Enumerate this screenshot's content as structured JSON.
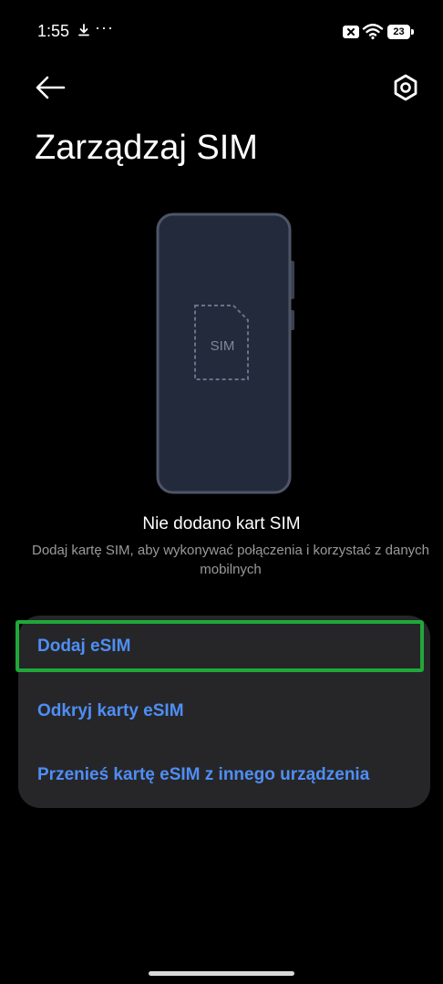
{
  "status_bar": {
    "time": "1:55",
    "more": "···",
    "battery_level": "23",
    "icons": [
      "download-icon",
      "sim-disabled-icon",
      "wifi-icon",
      "battery-icon"
    ]
  },
  "header": {
    "title": "Zarządzaj SIM",
    "back_icon": "back-arrow-icon",
    "settings_icon": "settings-icon"
  },
  "illustration": {
    "sim_label": "SIM"
  },
  "empty_state": {
    "title": "Nie dodano kart SIM",
    "description": "Dodaj kartę SIM, aby wykonywać połączenia i korzystać z danych mobilnych"
  },
  "options": [
    {
      "label": "Dodaj eSIM"
    },
    {
      "label": "Odkryj karty eSIM"
    },
    {
      "label": "Przenieś kartę eSIM z innego urządzenia"
    }
  ],
  "colors": {
    "background": "#000000",
    "card": "#262628",
    "link": "#4f8ef5",
    "highlight": "#1fa83a",
    "secondary_text": "#9a9a9a"
  }
}
